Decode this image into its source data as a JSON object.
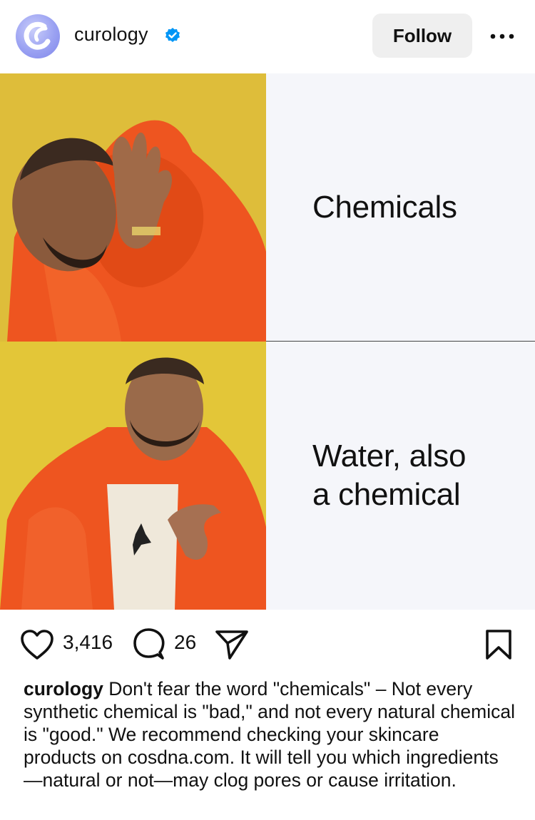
{
  "header": {
    "username": "curology",
    "follow_label": "Follow"
  },
  "post": {
    "panels": [
      {
        "text": "Chemicals"
      },
      {
        "text_line1": "Water, also",
        "text_line2": "a chemical"
      }
    ]
  },
  "actions": {
    "likes": "3,416",
    "comments": "26"
  },
  "caption": {
    "username": "curology",
    "text": "Don't fear the word \"chemicals\" – Not every synthetic chemical is \"bad,\" and not every natural chemical is \"good.\" We recommend checking your skincare products on cosdna.com. It will tell you which ingredients—natural or not—may clog pores or cause irritation."
  },
  "colors": {
    "verified": "#0095f6",
    "panel_background": "#f5f6fa",
    "meme_background": "#e3c638",
    "jacket": "#ee5520"
  },
  "icons": [
    "curology-logo-icon",
    "verified-icon",
    "more-options-icon",
    "heart-icon",
    "comment-icon",
    "share-icon",
    "bookmark-icon"
  ]
}
